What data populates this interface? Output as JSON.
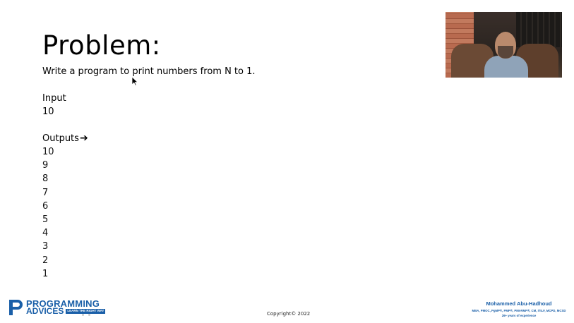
{
  "slide": {
    "title": "Problem:",
    "subtitle": "Write a program to print numbers from N to 1.",
    "input_label": "Input",
    "input_value": "10",
    "outputs_label": "Outputs",
    "outputs_arrow_icon": "arrow-right-icon",
    "outputs": [
      "10",
      "9",
      "8",
      "7",
      "6",
      "5",
      "4",
      "3",
      "2",
      "1"
    ]
  },
  "footer": {
    "logo_line1": "PROGRAMMING",
    "logo_line2": "ADVICES",
    "logo_tagline": "LEARN THE RIGHT WAY",
    "copyright": "Copyright© 2022",
    "author_name": "Mohammed Abu-Hadhoud",
    "author_credentials": "MBA, PMOC, PgMP®, PMP®, PMI-RMP®, CM, ITILF, MCPD, MCSD",
    "author_experience": "26+ years of experience"
  },
  "colors": {
    "brand_blue": "#1a5fa8",
    "text": "#000000",
    "background": "#ffffff"
  },
  "icons": {
    "cursor": "mouse-pointer-icon",
    "logo": "programming-advices-logo-icon"
  }
}
